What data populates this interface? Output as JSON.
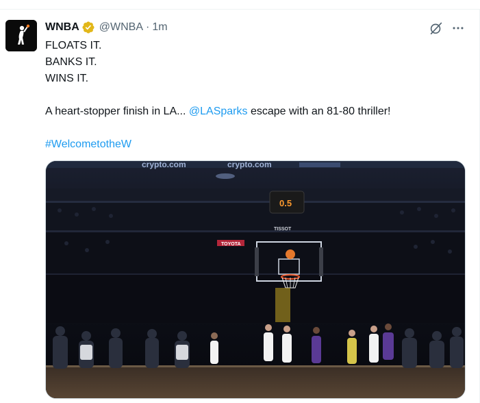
{
  "tweet": {
    "author": {
      "display_name": "WNBA",
      "handle": "@WNBA",
      "verified": true,
      "verified_color": "#e2b719"
    },
    "separator": "·",
    "time": "1m",
    "text": {
      "line1": "FLOATS IT.",
      "line2": "BANKS IT.",
      "line3": "WINS IT.",
      "sentence_before": "A heart-stopper finish in LA... ",
      "mention": "@LASparks",
      "sentence_after": " escape with an 81-80 thriller!",
      "hashtag": "#WelcometotheW"
    },
    "media": {
      "banner_text_1": "crypto.com",
      "banner_text_2": "crypto.com",
      "shot_clock": "0.5",
      "shot_clock_sponsor": "TISSOT",
      "arena_sign": "TOYOTA"
    },
    "actions": {
      "grok_icon": "grok-icon",
      "more_icon": "more-horizontal-icon"
    }
  },
  "colors": {
    "link": "#1d9bf0",
    "secondary_text": "#536471",
    "primary_text": "#0f1419"
  }
}
